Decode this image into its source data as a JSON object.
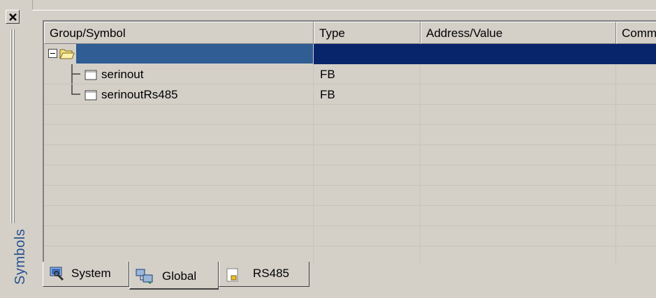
{
  "dock": {
    "title": "Symbols",
    "close_icon": "close-icon"
  },
  "grid": {
    "columns": [
      {
        "label": "Group/Symbol"
      },
      {
        "label": "Type"
      },
      {
        "label": "Address/Value"
      },
      {
        "label": "Comm"
      }
    ],
    "root_row": {
      "label": "",
      "expander": "minus",
      "icon": "folder-open-icon",
      "selected": true
    },
    "children": [
      {
        "label": "serinout",
        "type": "FB",
        "address": "",
        "comment": "",
        "icon": "function-block-icon"
      },
      {
        "label": "serinoutRs485",
        "type": "FB",
        "address": "",
        "comment": "",
        "icon": "function-block-icon"
      }
    ]
  },
  "tabs": [
    {
      "label": "System",
      "icon": "system-icon",
      "active": false
    },
    {
      "label": "Global",
      "icon": "global-icon",
      "active": true
    },
    {
      "label": "RS485",
      "icon": "file-icon",
      "active": false
    }
  ],
  "colors": {
    "selection": "#08246b",
    "selection_first_cell": "#2f5d94",
    "title_text": "#27518e",
    "window_bg": "#d4d0c8"
  }
}
